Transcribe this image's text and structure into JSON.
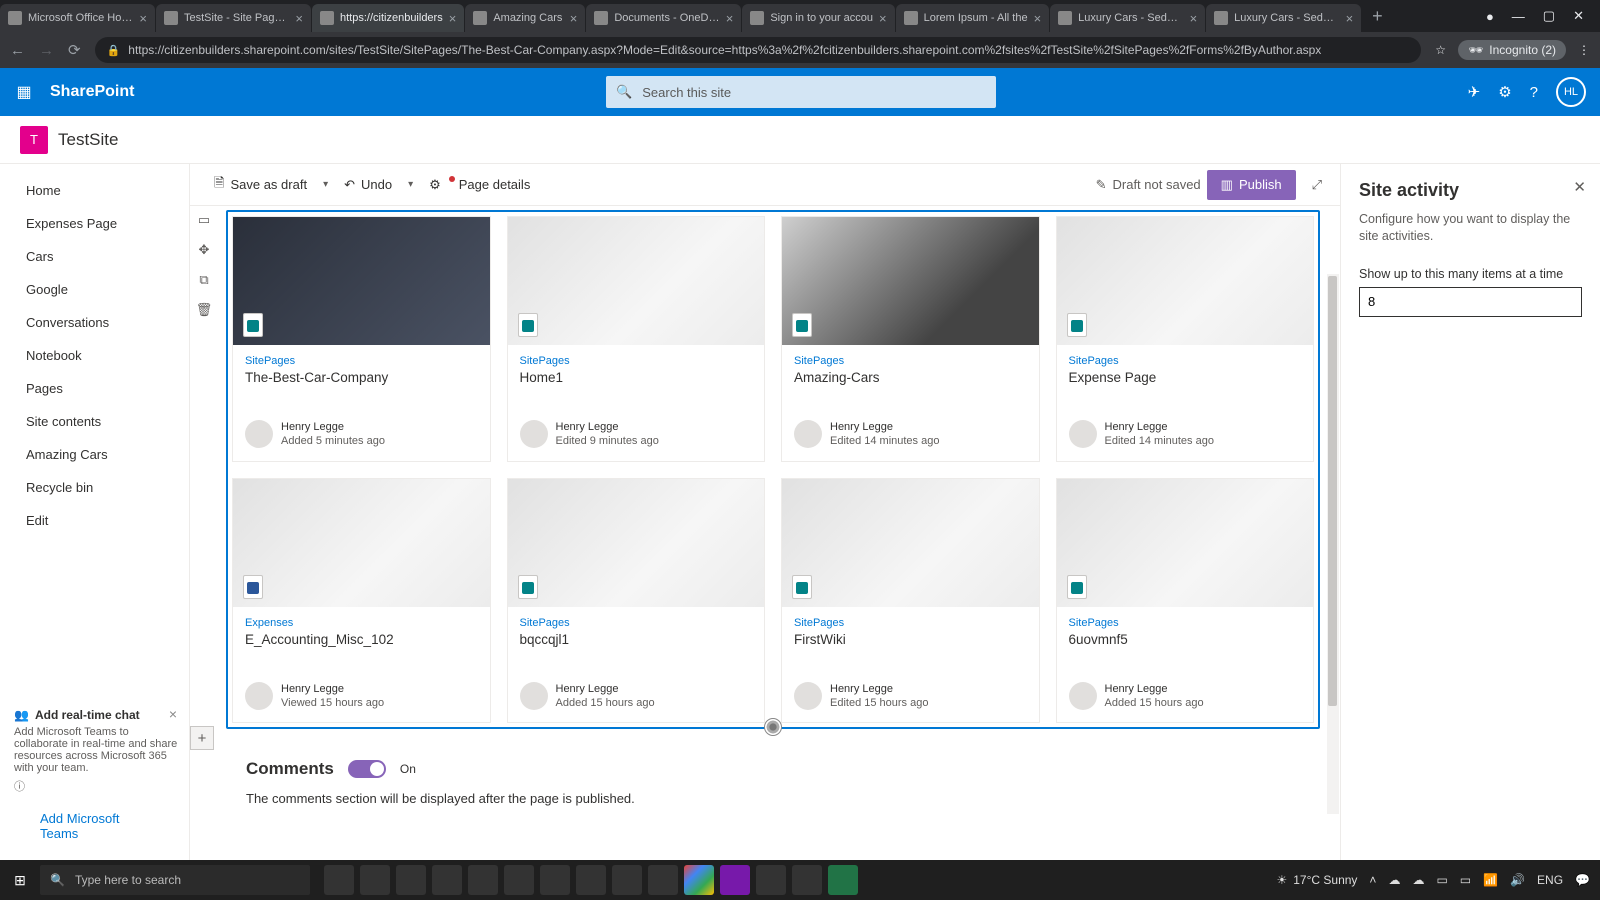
{
  "browser": {
    "tabs": [
      {
        "title": "Microsoft Office Home"
      },
      {
        "title": "TestSite - Site Pages -"
      },
      {
        "title": "https://citizenbuilders",
        "active": true
      },
      {
        "title": "Amazing Cars"
      },
      {
        "title": "Documents - OneDriv"
      },
      {
        "title": "Sign in to your accou"
      },
      {
        "title": "Lorem Ipsum - All the"
      },
      {
        "title": "Luxury Cars - Sedans,"
      },
      {
        "title": "Luxury Cars - Sedans,"
      }
    ],
    "url": "https://citizenbuilders.sharepoint.com/sites/TestSite/SitePages/The-Best-Car-Company.aspx?Mode=Edit&source=https%3a%2f%2fcitizenbuilders.sharepoint.com%2fsites%2fTestSite%2fSitePages%2fForms%2fByAuthor.aspx",
    "incognito": "Incognito (2)"
  },
  "suite": {
    "brand": "SharePoint",
    "searchPlaceholder": "Search this site",
    "avatar": "HL"
  },
  "site": {
    "logo": "T",
    "name": "TestSite"
  },
  "cmdbar": {
    "saveDraft": "Save as draft",
    "undo": "Undo",
    "pageDetails": "Page details",
    "draftNotSaved": "Draft not saved",
    "publish": "Publish"
  },
  "leftnav": [
    "Home",
    "Expenses Page",
    "Cars",
    "Google",
    "Conversations",
    "Notebook",
    "Pages",
    "Site contents",
    "Amazing Cars",
    "Recycle bin",
    "Edit"
  ],
  "teamsPromo": {
    "title": "Add real-time chat",
    "body": "Add Microsoft Teams to collaborate in real-time and share resources across Microsoft 365 with your team.",
    "link": "Add Microsoft Teams"
  },
  "activity": [
    {
      "cat": "SitePages",
      "title": "The-Best-Car-Company",
      "author": "Henry Legge",
      "meta": "Added 5 minutes ago",
      "img": "dark",
      "icon": "sp"
    },
    {
      "cat": "SitePages",
      "title": "Home1",
      "author": "Henry Legge",
      "meta": "Edited 9 minutes ago",
      "img": "light",
      "icon": "sp"
    },
    {
      "cat": "SitePages",
      "title": "Amazing-Cars",
      "author": "Henry Legge",
      "meta": "Edited 14 minutes ago",
      "img": "car",
      "icon": "sp"
    },
    {
      "cat": "SitePages",
      "title": "Expense Page",
      "author": "Henry Legge",
      "meta": "Edited 14 minutes ago",
      "img": "light",
      "icon": "sp"
    },
    {
      "cat": "Expenses",
      "title": "E_Accounting_Misc_102",
      "author": "Henry Legge",
      "meta": "Viewed 15 hours ago",
      "img": "light",
      "icon": "word"
    },
    {
      "cat": "SitePages",
      "title": "bqccqjl1",
      "author": "Henry Legge",
      "meta": "Added 15 hours ago",
      "img": "light",
      "icon": "sp"
    },
    {
      "cat": "SitePages",
      "title": "FirstWiki",
      "author": "Henry Legge",
      "meta": "Edited 15 hours ago",
      "img": "light",
      "icon": "sp"
    },
    {
      "cat": "SitePages",
      "title": "6uovmnf5",
      "author": "Henry Legge",
      "meta": "Added 15 hours ago",
      "img": "light",
      "icon": "sp"
    }
  ],
  "comments": {
    "heading": "Comments",
    "state": "On",
    "note": "The comments section will be displayed after the page is published."
  },
  "propPane": {
    "title": "Site activity",
    "desc": "Configure how you want to display the site activities.",
    "fieldLabel": "Show up to this many items at a time",
    "fieldValue": "8"
  },
  "taskbar": {
    "searchPlaceholder": "Type here to search",
    "weather": "17°C  Sunny",
    "lang": "ENG"
  }
}
